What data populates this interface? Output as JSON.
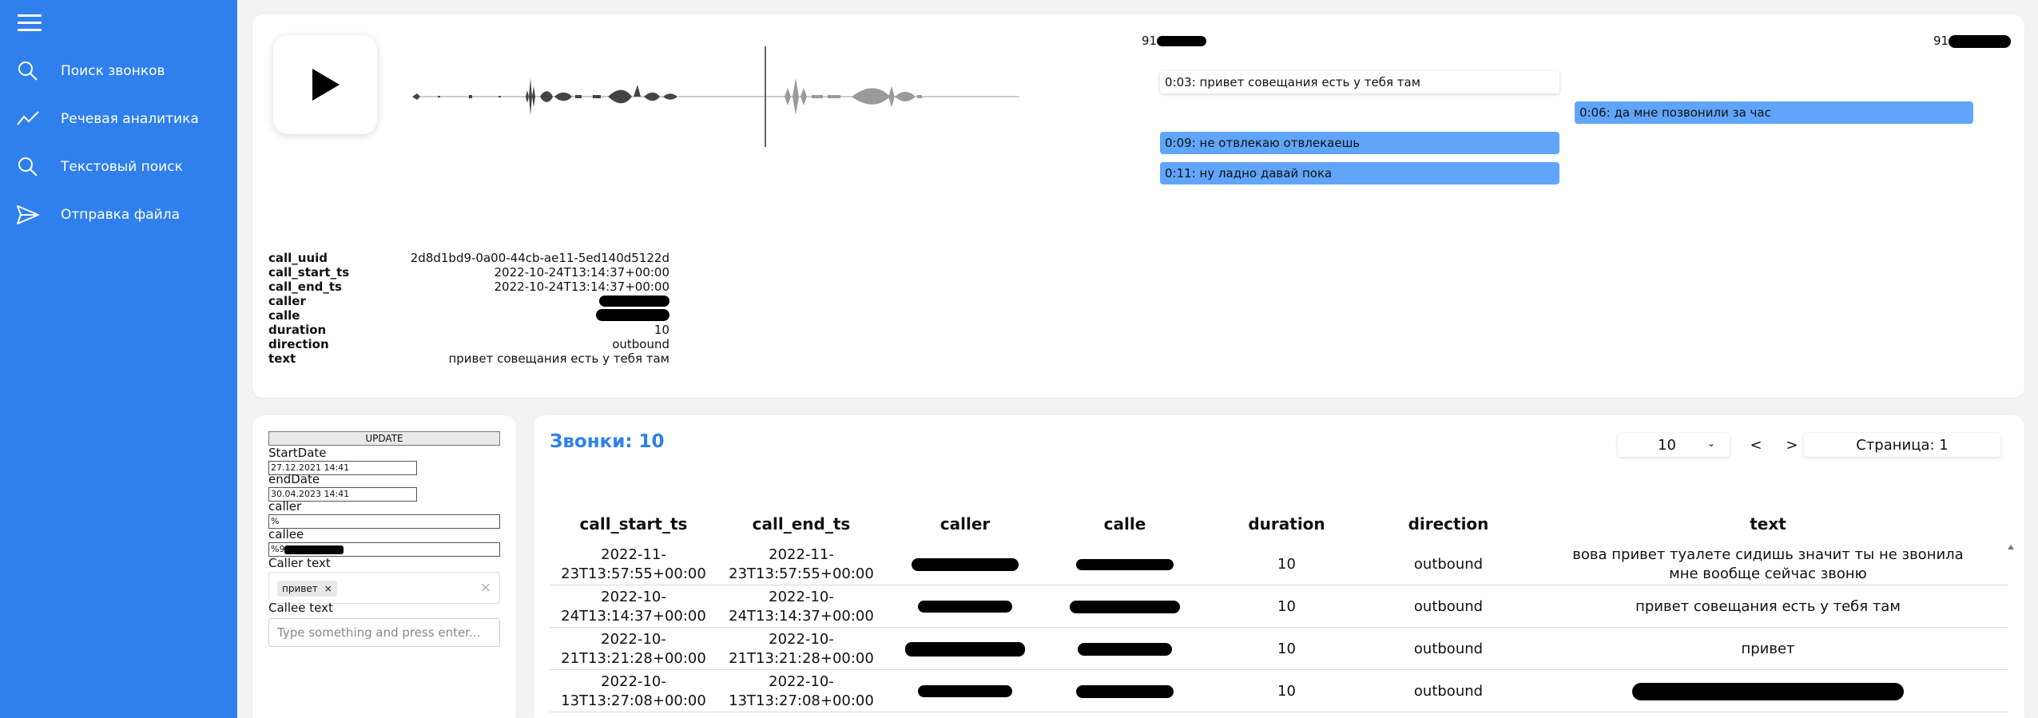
{
  "sidebar": {
    "items": [
      {
        "label": "Поиск звонков",
        "icon": "search-icon"
      },
      {
        "label": "Речевая аналитика",
        "icon": "trend-icon"
      },
      {
        "label": "Текстовый поиск",
        "icon": "search-icon"
      },
      {
        "label": "Отправка файла",
        "icon": "send-icon"
      }
    ]
  },
  "player": {
    "left_number": "91",
    "right_number": "91"
  },
  "messages": [
    {
      "text": "0:03: привет совещания есть у тебя там",
      "side": "left",
      "style": "white"
    },
    {
      "text": "0:06: да мне позвонили за час",
      "side": "right",
      "style": "blue"
    },
    {
      "text": "0:09: не отвлекаю отвлекаешь",
      "side": "left",
      "style": "blue"
    },
    {
      "text": "0:11: ну ладно давай пока",
      "side": "left",
      "style": "blue"
    }
  ],
  "details": {
    "call_uuid": {
      "key": "call_uuid",
      "value": "2d8d1bd9-0a00-44cb-ae11-5ed140d5122d"
    },
    "call_start_ts": {
      "key": "call_start_ts",
      "value": "2022-10-24T13:14:37+00:00"
    },
    "call_end_ts": {
      "key": "call_end_ts",
      "value": "2022-10-24T13:14:37+00:00"
    },
    "caller": {
      "key": "caller",
      "value": ""
    },
    "calle": {
      "key": "calle",
      "value": ""
    },
    "duration": {
      "key": "duration",
      "value": "10"
    },
    "direction": {
      "key": "direction",
      "value": "outbound"
    },
    "text": {
      "key": "text",
      "value": "привет совещания есть у тебя там"
    }
  },
  "filters": {
    "update_label": "UPDATE",
    "start_label": "StartDate",
    "start_value": "27.12.2021 14:41",
    "end_label": "endDate",
    "end_value": "30.04.2023 14:41",
    "caller_label": "caller",
    "caller_value": "%",
    "callee_label": "callee",
    "callee_value": "%9",
    "caller_text_label": "Caller text",
    "caller_text_chip": "привет",
    "chip_remove": "×",
    "clear_all": "×",
    "callee_text_label": "Callee text",
    "callee_text_placeholder": "Type something and press enter..."
  },
  "table": {
    "title": "Звонки: 10",
    "page_size": "10",
    "prev": "<",
    "next": ">",
    "page_label": "Страница: 1",
    "headers": [
      "call_start_ts",
      "call_end_ts",
      "caller",
      "calle",
      "duration",
      "direction",
      "text"
    ],
    "rows": [
      {
        "start": "2022-11-23T13:57:55+00:00",
        "end": "2022-11-23T13:57:55+00:00",
        "duration": "10",
        "direction": "outbound",
        "text": "вова привет туалете сидишь значит ты не звонила мне вообще сейчас звоню"
      },
      {
        "start": "2022-10-24T13:14:37+00:00",
        "end": "2022-10-24T13:14:37+00:00",
        "duration": "10",
        "direction": "outbound",
        "text": "привет совещания есть у тебя там"
      },
      {
        "start": "2022-10-21T13:21:28+00:00",
        "end": "2022-10-21T13:21:28+00:00",
        "duration": "10",
        "direction": "outbound",
        "text": "привет"
      },
      {
        "start": "2022-10-13T13:27:08+00:00",
        "end": "2022-10-13T13:27:08+00:00",
        "duration": "10",
        "direction": "outbound",
        "text": ""
      }
    ]
  },
  "colors": {
    "accent": "#2f80ed",
    "bubble_blue": "#60a5fa"
  }
}
